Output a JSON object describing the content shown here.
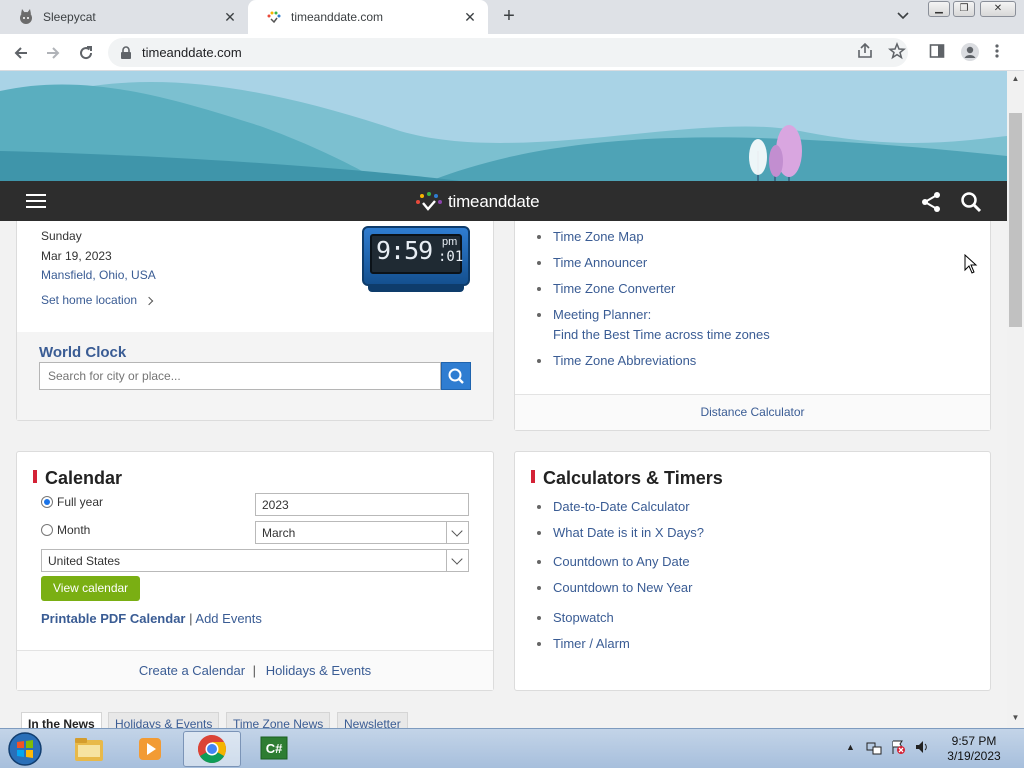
{
  "browser": {
    "tabs": [
      {
        "title": "Sleepycat",
        "active": false
      },
      {
        "title": "timeanddate.com",
        "active": true
      }
    ],
    "url": "timeanddate.com"
  },
  "site": {
    "logo_text": "timeanddate"
  },
  "clock_card": {
    "day": "Sunday",
    "date": "Mar 19, 2023",
    "location": "Mansfield, Ohio, USA",
    "set_home_label": "Set home location",
    "clock_time": "9:59",
    "clock_ampm": "pm",
    "clock_seconds": ":01",
    "world_clock_title": "World Clock",
    "search_placeholder": "Search for city or place..."
  },
  "tz_card": {
    "links": [
      "Time Zone Map",
      "Time Announcer",
      "Time Zone Converter",
      "Meeting Planner:",
      "Find the Best Time across time zones",
      "Time Zone Abbreviations"
    ],
    "footer_link": "Distance Calculator"
  },
  "calendar_card": {
    "title": "Calendar",
    "full_year_label": "Full year",
    "month_label": "Month",
    "year_value": "2023",
    "month_value": "March",
    "country_value": "United States",
    "view_button": "View calendar",
    "printable_link": "Printable PDF Calendar",
    "separator": "|",
    "add_events_link": "Add Events",
    "footer_create": "Create a Calendar",
    "footer_sep": "|",
    "footer_holidays": "Holidays & Events"
  },
  "calc_card": {
    "title": "Calculators & Timers",
    "links": [
      "Date-to-Date Calculator",
      "What Date is it in X Days?",
      "Countdown to Any Date",
      "Countdown to New Year",
      "Stopwatch",
      "Timer / Alarm"
    ]
  },
  "news_tabs": [
    "In the News",
    "Holidays & Events",
    "Time Zone News",
    "Newsletter"
  ],
  "taskbar": {
    "time": "9:57 PM",
    "date": "3/19/2023"
  },
  "colors": {
    "accent_red": "#d42236",
    "link_blue": "#3a5c94",
    "button_green": "#7aaf13",
    "site_bar": "#2d2d2d",
    "search_button": "#2f7dd1"
  }
}
